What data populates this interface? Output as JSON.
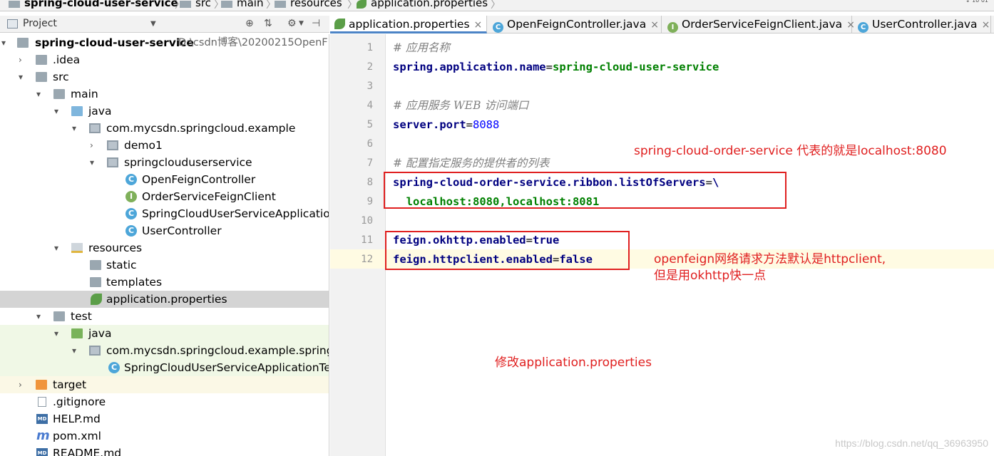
{
  "breadcrumb": {
    "project": "spring-cloud-user-service",
    "items": [
      "src",
      "main",
      "resources",
      "application.properties"
    ]
  },
  "project_panel": {
    "title": "Project"
  },
  "tree": [
    {
      "label": "spring-cloud-user-service",
      "hint": "D:\\csdn博客\\20200215OpenF"
    },
    {
      "label": ".idea"
    },
    {
      "label": "src"
    },
    {
      "label": "main"
    },
    {
      "label": "java"
    },
    {
      "label": "com.mycsdn.springcloud.example"
    },
    {
      "label": "demo1"
    },
    {
      "label": "springclouduserservice"
    },
    {
      "label": "OpenFeignController",
      "badge": "C"
    },
    {
      "label": "OrderServiceFeignClient",
      "badge": "I"
    },
    {
      "label": "SpringCloudUserServiceApplication",
      "badge": "C"
    },
    {
      "label": "UserController",
      "badge": "C"
    },
    {
      "label": "resources"
    },
    {
      "label": "static"
    },
    {
      "label": "templates"
    },
    {
      "label": "application.properties"
    },
    {
      "label": "test"
    },
    {
      "label": "java"
    },
    {
      "label": "com.mycsdn.springcloud.example.springcl"
    },
    {
      "label": "SpringCloudUserServiceApplicationTest",
      "badge": "C"
    },
    {
      "label": "target"
    },
    {
      "label": ".gitignore"
    },
    {
      "label": "HELP.md",
      "badge": "MD"
    },
    {
      "label": "pom.xml",
      "badge": "m"
    },
    {
      "label": "README.md",
      "badge": "MD"
    }
  ],
  "tabs": [
    {
      "label": "application.properties",
      "badge": "",
      "close": "×"
    },
    {
      "label": "OpenFeignController.java",
      "badge": "C",
      "close": "×"
    },
    {
      "label": "OrderServiceFeignClient.java",
      "badge": "I",
      "close": "×"
    },
    {
      "label": "UserController.java",
      "badge": "C",
      "close": "×"
    }
  ],
  "line_numbers": [
    "1",
    "2",
    "3",
    "4",
    "5",
    "6",
    "7",
    "8",
    "9",
    "10",
    "11",
    "12"
  ],
  "code": {
    "l1": "# 应用名称",
    "l2_key": "spring.application.name",
    "l2_val": "spring-cloud-user-service",
    "l4": "# 应用服务 WEB 访问端口",
    "l5_key": "server.port",
    "l5_val": "8088",
    "l7": "# 配置指定服务的提供者的列表",
    "l8_key": "spring-cloud-order-service.ribbon.listOfServers",
    "l8_val": "\\",
    "l9_val": "  localhost:8080,localhost:8081",
    "l11_key": "feign.okhttp.enabled",
    "l11_val": "true",
    "l12_key": "feign.httpclient.enabled",
    "l12_val": "false",
    "eq": "="
  },
  "annotations": {
    "note1": "spring-cloud-order-service 代表的就是localhost:8080",
    "note2_line1": "openfeign网络请求方法默认是httpclient,",
    "note2_line2": "但是用okhttp快一点",
    "note3": "修改application.properties"
  },
  "watermark": "https://blog.csdn.net/qq_36963950",
  "sort_icon": "↕ 10 01",
  "colors": {
    "annotation": "#e02020",
    "key": "#000080",
    "value": "#008000",
    "comment": "#808080",
    "selection": "#d4d4d4"
  }
}
